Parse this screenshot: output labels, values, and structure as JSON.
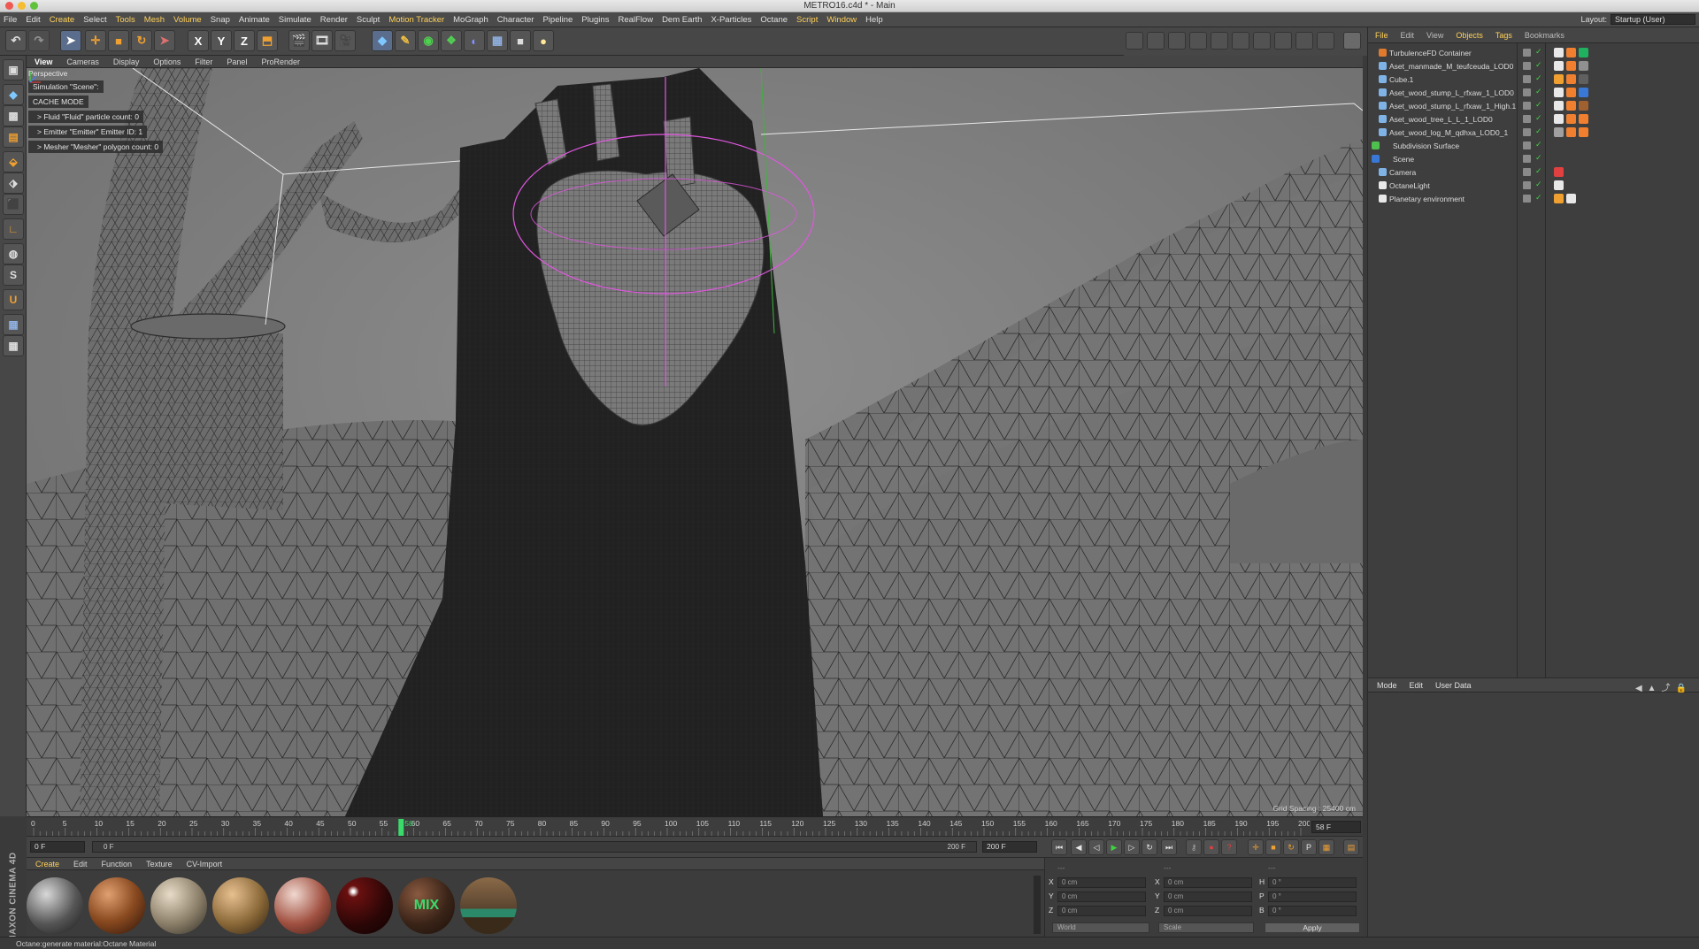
{
  "window": {
    "title": "METRO16.c4d * - Main"
  },
  "menubar": {
    "items": [
      {
        "label": "File"
      },
      {
        "label": "Edit"
      },
      {
        "label": "Create"
      },
      {
        "label": "Select"
      },
      {
        "label": "Tools"
      },
      {
        "label": "Mesh"
      },
      {
        "label": "Volume"
      },
      {
        "label": "Snap"
      },
      {
        "label": "Animate"
      },
      {
        "label": "Simulate"
      },
      {
        "label": "Render"
      },
      {
        "label": "Sculpt"
      },
      {
        "label": "Motion Tracker"
      },
      {
        "label": "MoGraph"
      },
      {
        "label": "Character"
      },
      {
        "label": "Pipeline"
      },
      {
        "label": "Plugins"
      },
      {
        "label": "RealFlow"
      },
      {
        "label": "Dem Earth"
      },
      {
        "label": "X-Particles"
      },
      {
        "label": "Octane"
      },
      {
        "label": "Script"
      },
      {
        "label": "Window"
      },
      {
        "label": "Help"
      }
    ],
    "layout_label": "Layout:",
    "layout_value": "Startup (User)"
  },
  "toolbar": {
    "axis_x": "X",
    "axis_y": "Y",
    "axis_z": "Z"
  },
  "viewport": {
    "menu": [
      {
        "label": "View"
      },
      {
        "label": "Cameras"
      },
      {
        "label": "Display"
      },
      {
        "label": "Options"
      },
      {
        "label": "Filter"
      },
      {
        "label": "Panel"
      },
      {
        "label": "ProRender"
      }
    ],
    "view_name": "Perspective",
    "hud": {
      "simulation": "Simulation \"Scene\":",
      "cache_mode": "CACHE MODE",
      "rows": [
        "> Fluid \"Fluid\" particle count: 0",
        "> Emitter \"Emitter\" Emitter ID: 1",
        "> Mesher \"Mesher\" polygon count: 0"
      ]
    },
    "grid_spacing": "Grid Spacing : 25400 cm"
  },
  "timeline": {
    "ticks": [
      "0",
      "5",
      "10",
      "15",
      "20",
      "25",
      "30",
      "35",
      "40",
      "45",
      "50",
      "55",
      "60",
      "65",
      "70",
      "75",
      "80",
      "85",
      "90",
      "95",
      "100",
      "105",
      "110",
      "115",
      "120",
      "125",
      "130",
      "135",
      "140",
      "145",
      "150",
      "155",
      "160",
      "165",
      "170",
      "175",
      "180",
      "185",
      "190",
      "195",
      "200"
    ],
    "current_frame": "58",
    "current_frame_label": "58 F"
  },
  "transport": {
    "start": "0 F",
    "range_start": "0 F",
    "range_end": "200 F",
    "end": "200 F"
  },
  "materials": {
    "menu": [
      {
        "label": "Create"
      },
      {
        "label": "Edit"
      },
      {
        "label": "Function"
      },
      {
        "label": "Texture"
      },
      {
        "label": "CV-Import"
      }
    ],
    "mix_label": "MIX"
  },
  "branding": {
    "logo_text": "MAXON CINEMA 4D"
  },
  "coordinates": {
    "header": [
      "---",
      "---",
      "---"
    ],
    "rows": [
      {
        "pos_label": "X",
        "pos": "0 cm",
        "size_label": "X",
        "size": "0 cm",
        "rot_label": "H",
        "rot": "0 °"
      },
      {
        "pos_label": "Y",
        "pos": "0 cm",
        "size_label": "Y",
        "size": "0 cm",
        "rot_label": "P",
        "rot": "0 °"
      },
      {
        "pos_label": "Z",
        "pos": "0 cm",
        "size_label": "Z",
        "size": "0 cm",
        "rot_label": "B",
        "rot": "0 °"
      }
    ],
    "space": "World",
    "mode": "Scale",
    "apply": "Apply"
  },
  "object_manager": {
    "menu": [
      {
        "label": "File"
      },
      {
        "label": "Edit"
      },
      {
        "label": "View"
      },
      {
        "label": "Objects"
      },
      {
        "label": "Tags"
      },
      {
        "label": "Bookmarks"
      }
    ],
    "objects": [
      {
        "name": "TurbulenceFD Container",
        "icon_color": "#e07a2e"
      },
      {
        "name": "Aset_manmade_M_teufceuda_LOD0",
        "icon_color": "#7fb3e6"
      },
      {
        "name": "Cube.1",
        "icon_color": "#7fb3e6"
      },
      {
        "name": "Aset_wood_stump_L_rfxaw_1_LOD0",
        "icon_color": "#7fb3e6"
      },
      {
        "name": "Aset_wood_stump_L_rfxaw_1_High.1",
        "icon_color": "#7fb3e6"
      },
      {
        "name": "Aset_wood_tree_L_L_1_LOD0",
        "icon_color": "#7fb3e6"
      },
      {
        "name": "Aset_wood_log_M_qdhxa_LOD0_1",
        "icon_color": "#7fb3e6"
      },
      {
        "name": "Subdivision Surface",
        "icon_color": "#4ec04e"
      },
      {
        "name": "Scene",
        "icon_color": "#3a78d8"
      },
      {
        "name": "Camera",
        "icon_color": "#7fb3e6"
      },
      {
        "name": "OctaneLight",
        "icon_color": "#e8e8e8"
      },
      {
        "name": "Planetary environment",
        "icon_color": "#e8e8e8"
      }
    ]
  },
  "attribute_manager": {
    "menu": [
      {
        "label": "Mode"
      },
      {
        "label": "Edit"
      },
      {
        "label": "User Data"
      }
    ]
  },
  "status": {
    "text": "Octane:generate material:Octane Material"
  },
  "colors": {
    "accent": "#ffd15a",
    "selection": "#e056e0",
    "frame_marker": "#3adb6b"
  }
}
